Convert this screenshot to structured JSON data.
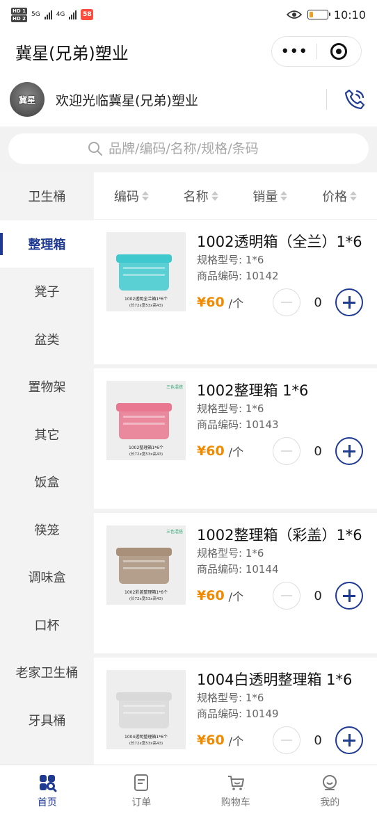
{
  "status_bar": {
    "sim1": "HD 1",
    "sim2": "HD 2",
    "net1": "5G",
    "net2": "4G",
    "time": "10:10",
    "battery_level": 0.2
  },
  "titlebar": {
    "title": "冀星(兄弟)塑业",
    "more_icon": "more-dots-icon",
    "close_icon": "target-icon"
  },
  "shop": {
    "logo_text": "冀星",
    "logo_sub": "Jixing",
    "welcome": "欢迎光临冀星(兄弟)塑业",
    "phone_icon": "phone-icon"
  },
  "search": {
    "placeholder": "品牌/编码/名称/规格/条码"
  },
  "sidebar": {
    "items": [
      {
        "label": "卫生桶",
        "active": false
      },
      {
        "label": "整理箱",
        "active": true
      },
      {
        "label": "凳子",
        "active": false
      },
      {
        "label": "盆类",
        "active": false
      },
      {
        "label": "置物架",
        "active": false
      },
      {
        "label": "其它",
        "active": false
      },
      {
        "label": "饭盒",
        "active": false
      },
      {
        "label": "筷笼",
        "active": false
      },
      {
        "label": "调味盒",
        "active": false
      },
      {
        "label": "口杯",
        "active": false
      },
      {
        "label": "老家卫生桶",
        "active": false
      },
      {
        "label": "牙具桶",
        "active": false
      }
    ]
  },
  "sort": {
    "items": [
      {
        "label": "编码"
      },
      {
        "label": "名称"
      },
      {
        "label": "销量"
      },
      {
        "label": "价格"
      }
    ]
  },
  "products": [
    {
      "name": "1002透明箱（全兰）1*6",
      "spec": "规格型号: 1*6",
      "code": "商品编码: 10142",
      "price": "¥60",
      "unit": "/个",
      "qty": "0",
      "img_caption": "1002透明全兰箱1*6个",
      "img_size": "(长72x宽53x高43)",
      "img_tag": "",
      "img_color": "#3fc9cf"
    },
    {
      "name": "1002整理箱 1*6",
      "spec": "规格型号: 1*6",
      "code": "商品编码: 10143",
      "price": "¥60",
      "unit": "/个",
      "qty": "0",
      "img_caption": "1002整理箱1*6个",
      "img_size": "(长72x宽53x高43)",
      "img_tag": "三色混搭",
      "img_color": "#e9778f"
    },
    {
      "name": "1002整理箱（彩盖）1*6",
      "spec": "规格型号: 1*6",
      "code": "商品编码: 10144",
      "price": "¥60",
      "unit": "/个",
      "qty": "0",
      "img_caption": "1002彩盖整理箱1*6个",
      "img_size": "(长72x宽53x高43)",
      "img_tag": "三色混搭",
      "img_color": "#a8907a"
    },
    {
      "name": "1004白透明整理箱 1*6",
      "spec": "规格型号: 1*6",
      "code": "商品编码: 10149",
      "price": "¥60",
      "unit": "/个",
      "qty": "0",
      "img_caption": "1004透明整理箱1*6个",
      "img_size": "(长72x宽53x高43)",
      "img_tag": "",
      "img_color": "#d9d9d9"
    }
  ],
  "tabbar": {
    "items": [
      {
        "label": "首页",
        "icon": "home-grid-icon",
        "active": true
      },
      {
        "label": "订单",
        "icon": "order-icon",
        "active": false
      },
      {
        "label": "购物车",
        "icon": "cart-icon",
        "active": false
      },
      {
        "label": "我的",
        "icon": "profile-icon",
        "active": false
      }
    ]
  },
  "colors": {
    "accent": "#1f3a93",
    "price": "#f08a00",
    "sidebar_bg": "#f3f3f3"
  }
}
